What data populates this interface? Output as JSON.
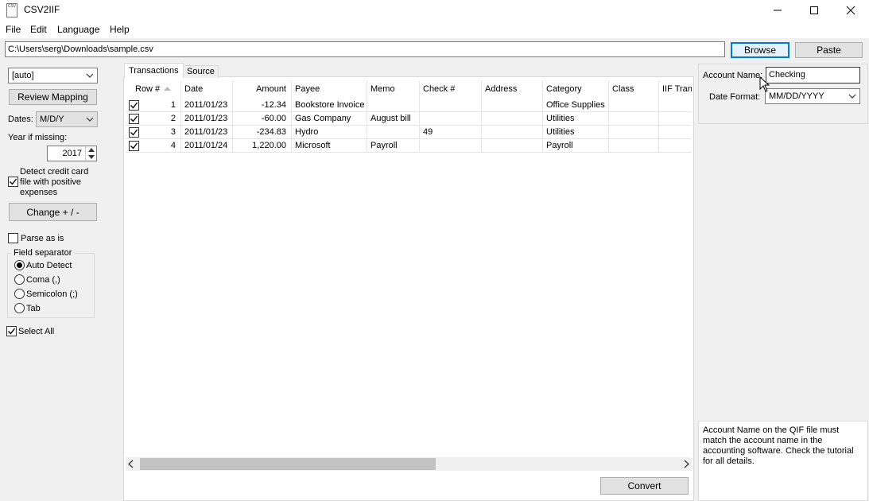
{
  "window": {
    "title": "CSV2IIF",
    "icon_text": "CSV"
  },
  "menu": [
    "File",
    "Edit",
    "Language",
    "Help"
  ],
  "path_bar": {
    "file_path": "C:\\Users\\serg\\Downloads\\sample.csv",
    "browse_label": "Browse",
    "paste_label": "Paste"
  },
  "left_panel": {
    "mapping_select": "[auto]",
    "review_mapping_label": "Review Mapping",
    "dates_label": "Dates:",
    "dates_value": "M/D/Y",
    "year_missing_label": "Year if missing:",
    "year_value": "2017",
    "detect_cc_label": "Detect credit card file with positive expenses",
    "detect_cc_line1": "Detect credit card",
    "detect_cc_line2": "file with positive",
    "detect_cc_line3": "expenses",
    "detect_cc_checked": true,
    "change_sign_label": "Change + / -",
    "parse_as_is_label": "Parse as is",
    "parse_as_is_checked": false,
    "field_separator_label": "Field separator",
    "separators": [
      "Auto Detect",
      "Coma (,)",
      "Semicolon (;)",
      "Tab"
    ],
    "selected_separator": "Auto Detect",
    "select_all_label": "Select All",
    "select_all_checked": true
  },
  "tabs": [
    "Transactions",
    "Source"
  ],
  "active_tab": "Transactions",
  "grid": {
    "columns": [
      "Row #",
      "Date",
      "Amount",
      "Payee",
      "Memo",
      "Check #",
      "Address",
      "Category",
      "Class",
      "IIF Tran"
    ],
    "rows": [
      {
        "checked": true,
        "row": "1",
        "date": "2011/01/23",
        "amount": "-12.34",
        "payee": "Bookstore Invoice",
        "memo": "",
        "check": "",
        "address": "",
        "category": "Office Supplies",
        "class": ""
      },
      {
        "checked": true,
        "row": "2",
        "date": "2011/01/23",
        "amount": "-60.00",
        "payee": "Gas Company",
        "memo": "August bill",
        "check": "",
        "address": "",
        "category": "Utilities",
        "class": ""
      },
      {
        "checked": true,
        "row": "3",
        "date": "2011/01/23",
        "amount": "-234.83",
        "payee": "Hydro",
        "memo": "",
        "check": "49",
        "address": "",
        "category": "Utilities",
        "class": ""
      },
      {
        "checked": true,
        "row": "4",
        "date": "2011/01/24",
        "amount": "1,220.00",
        "payee": "Microsoft",
        "memo": "Payroll",
        "check": "",
        "address": "",
        "category": "Payroll",
        "class": ""
      }
    ]
  },
  "convert_label": "Convert",
  "right_panel": {
    "account_name_label": "Account Name:",
    "account_name_value": "Checking",
    "date_format_label": "Date Format:",
    "date_format_value": "MM/DD/YYYY",
    "help_text": "Account Name on the QIF file must match the account name in the accounting software. Check the tutorial for all details."
  },
  "colors": {
    "accent": "#0078d7",
    "window_bg": "#f0f0f0"
  }
}
